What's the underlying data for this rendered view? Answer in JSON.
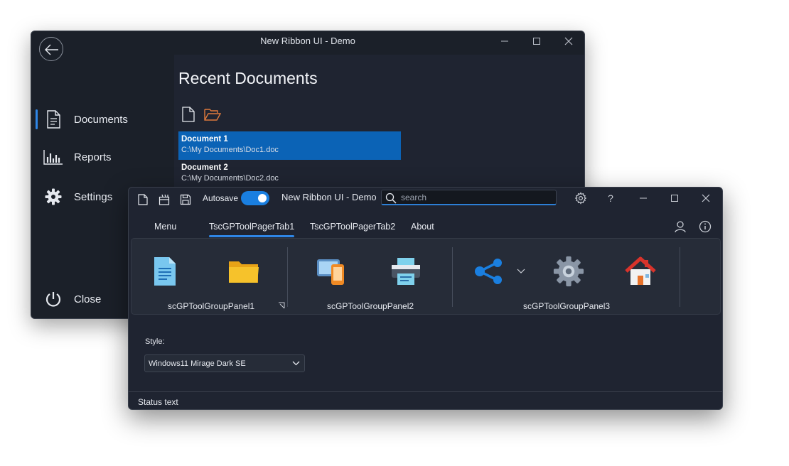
{
  "back_window": {
    "title": "New Ribbon UI - Demo",
    "nav": [
      {
        "label": "Documents",
        "icon": "document-icon",
        "selected": true
      },
      {
        "label": "Reports",
        "icon": "bar-chart-icon",
        "selected": false
      },
      {
        "label": "Settings",
        "icon": "gear-icon",
        "selected": false
      },
      {
        "label": "Close",
        "icon": "power-icon",
        "selected": false
      }
    ],
    "heading": "Recent Documents",
    "toolbar_icons": [
      "new-document-icon",
      "open-folder-icon"
    ],
    "documents": [
      {
        "name": "Document 1",
        "path": "C:\\My Documents\\Doc1.doc",
        "selected": true
      },
      {
        "name": "Document 2",
        "path": "C:\\My Documents\\Doc2.doc",
        "selected": false
      }
    ]
  },
  "front_window": {
    "title": "New Ribbon UI - Demo",
    "quick_access": [
      "new-document-icon",
      "open-icon",
      "save-icon"
    ],
    "autosave": {
      "label": "Autosave",
      "on": true
    },
    "search": {
      "placeholder": "search",
      "value": ""
    },
    "titlebar_buttons": [
      "gear-icon",
      "help-icon",
      "minimize-icon",
      "maximize-icon",
      "close-icon"
    ],
    "help_glyph": "?",
    "tabs": [
      {
        "label": "Menu",
        "active": false
      },
      {
        "label": "TscGPToolPagerTab1",
        "active": true
      },
      {
        "label": "TscGPToolPagerTab2",
        "active": false
      },
      {
        "label": "About",
        "active": false
      }
    ],
    "groups": [
      {
        "label": "scGPToolGroupPanel1",
        "buttons": [
          "document-icon",
          "folder-icon"
        ]
      },
      {
        "label": "scGPToolGroupPanel2",
        "buttons": [
          "devices-icon",
          "printer-icon"
        ]
      },
      {
        "label": "scGPToolGroupPanel3",
        "buttons": [
          "share-icon",
          "settings-icon",
          "home-icon"
        ]
      }
    ],
    "style_label": "Style:",
    "style_value": "Windows11 Mirage Dark SE",
    "status_text": "Status text"
  },
  "colors": {
    "accent": "#2f86e6",
    "selection": "#0b63b6",
    "background": "#1f2431"
  }
}
